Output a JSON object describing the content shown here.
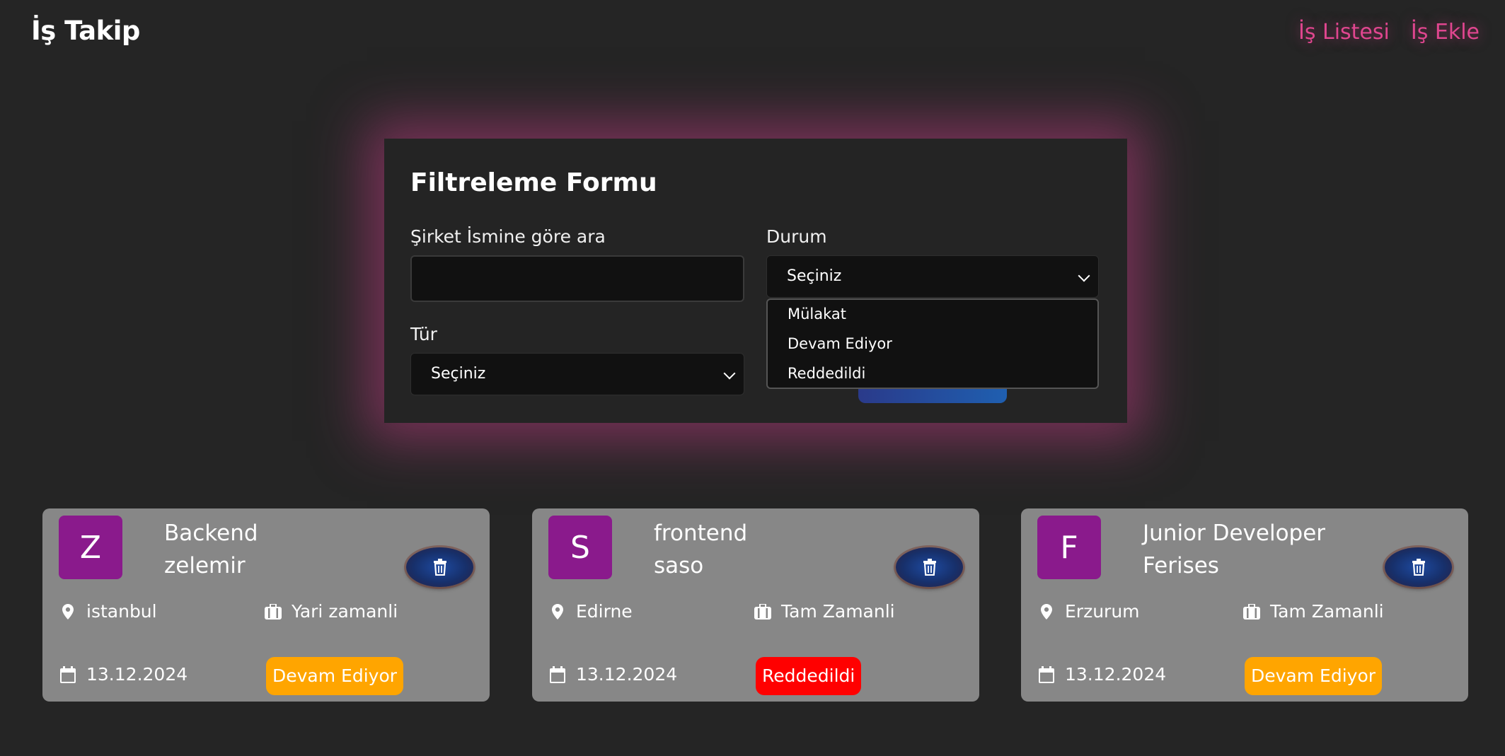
{
  "header": {
    "brand": "İş Takip",
    "nav": [
      "İş Listesi",
      "İş Ekle"
    ]
  },
  "filter": {
    "title": "Filtreleme Formu",
    "company_label": "Şirket İsmine göre ara",
    "company_value": "",
    "status_label": "Durum",
    "status_selected": "Seçiniz",
    "status_options": [
      "Mülakat",
      "Devam Ediyor",
      "Reddedildi"
    ],
    "type_label": "Tür",
    "type_selected": "Seçiniz"
  },
  "cards": [
    {
      "initial": "Z",
      "position": "Backend",
      "company": "zelemir",
      "location": "istanbul",
      "type": "Yari zamanli",
      "date": "13.12.2024",
      "status": "Devam Ediyor",
      "status_color": "#ffa500"
    },
    {
      "initial": "S",
      "position": "frontend",
      "company": "saso",
      "location": "Edirne",
      "type": "Tam Zamanli",
      "date": "13.12.2024",
      "status": "Reddedildi",
      "status_color": "#ff0000"
    },
    {
      "initial": "F",
      "position": "Junior Developer",
      "company": "Ferises",
      "location": "Erzurum",
      "type": "Tam Zamanli",
      "date": "13.12.2024",
      "status": "Devam Ediyor",
      "status_color": "#ffa500"
    }
  ],
  "colors": {
    "accent": "#e0468f",
    "avatar": "#8a1a8c",
    "card_bg": "#878787",
    "page_bg": "#252525"
  }
}
